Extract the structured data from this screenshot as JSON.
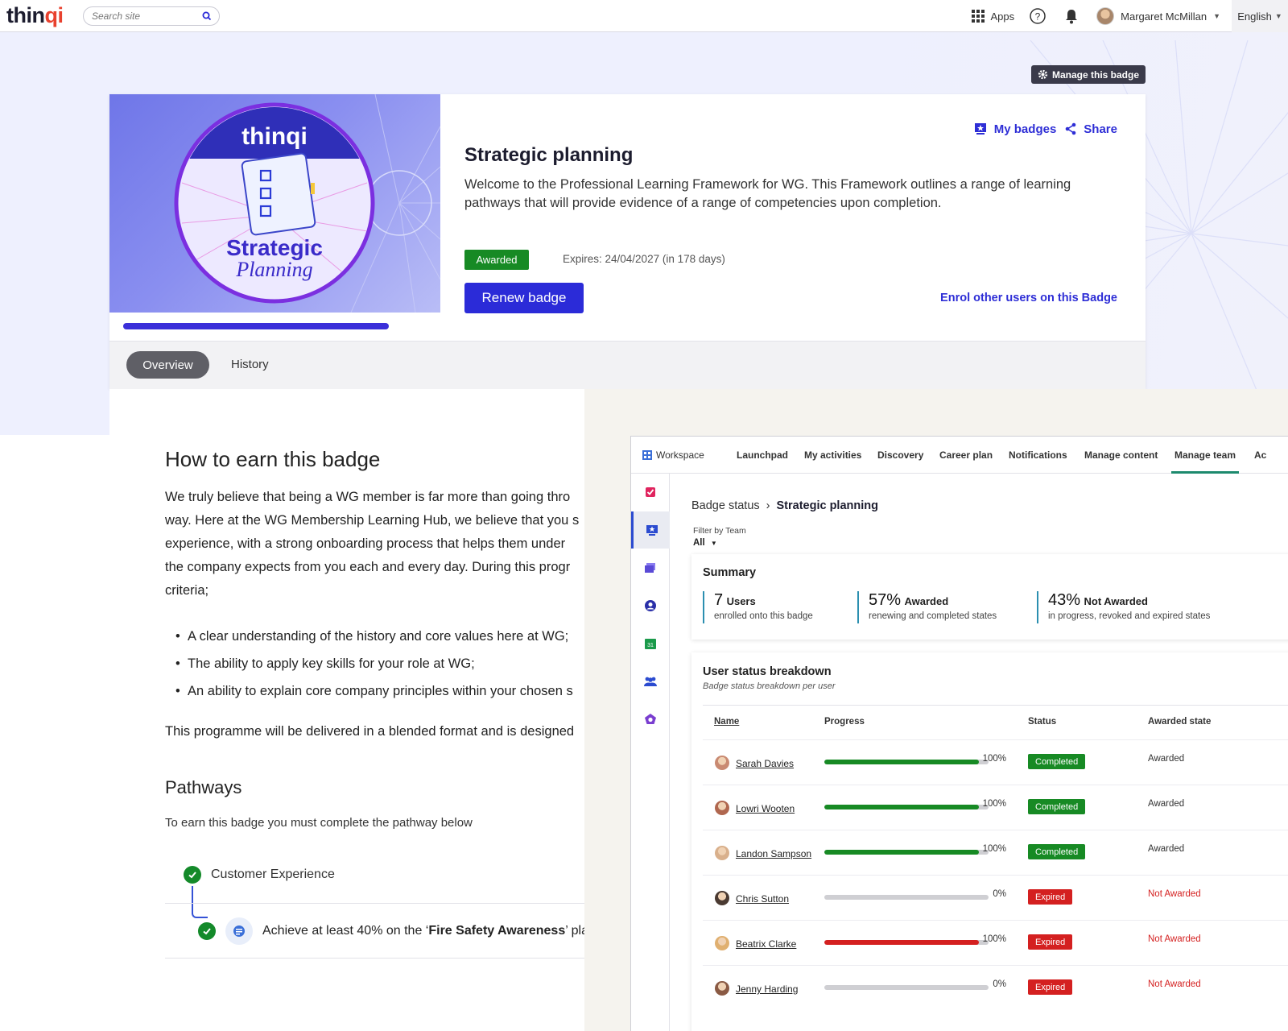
{
  "topbar": {
    "logo_main": "thin",
    "logo_accent": "qi",
    "search_placeholder": "Search site",
    "apps_label": "Apps",
    "user_name": "Margaret McMillan",
    "language": "English"
  },
  "manage_badge_label": "Manage this badge",
  "badge": {
    "image_brand": "thinqi",
    "image_title_line1": "Strategic",
    "image_title_line2": "Planning",
    "title": "Strategic planning",
    "description": "Welcome to the Professional Learning Framework for WG. This Framework outlines a range of learning pathways that will provide evidence of a range of competencies upon completion.",
    "my_badges_label": "My badges",
    "share_label": "Share",
    "status_pill": "Awarded",
    "expires": "Expires: 24/04/2027 (in 178 days)",
    "renew_label": "Renew badge",
    "enrol_label": "Enrol other users on this Badge",
    "tabs": [
      "Overview",
      "History"
    ],
    "colors": {
      "primary": "#2b2bd8",
      "awarded": "#178a24"
    }
  },
  "content": {
    "heading": "How to earn this badge",
    "paragraph_lines": [
      "We truly believe that being a WG member is far more than going thro",
      "way. Here at the WG Membership Learning Hub, we believe that you s",
      "experience, with a strong onboarding process that helps them under",
      "the company expects from you each and every day. During this progr",
      "criteria;"
    ],
    "bullets": [
      "A clear understanding of the history and core values here at WG;",
      "The ability to apply key skills for your role at WG;",
      "An ability to explain core company principles within your chosen s"
    ],
    "delivered": "This programme will be delivered in a blended format and is designed",
    "pathways_heading": "Pathways",
    "pathways_intro": "To earn this badge you must complete the pathway below",
    "step1": "Customer Experience",
    "step2_prefix": "Achieve at least 40% on the ‘",
    "step2_bold": "Fire Safety Awareness",
    "step2_suffix": "’ playl"
  },
  "manage_team": {
    "nav": {
      "workspace": "Workspace",
      "items": [
        "Launchpad",
        "My activities",
        "Discovery",
        "Career plan",
        "Notifications",
        "Manage content",
        "Manage team",
        "Ac"
      ],
      "active": "Manage team"
    },
    "breadcrumb": {
      "parent": "Badge status",
      "current": "Strategic planning"
    },
    "filter_label": "Filter by Team",
    "filter_value": "All",
    "summary": {
      "title": "Summary",
      "stats": [
        {
          "value": "7",
          "label": "Users",
          "sub": "enrolled onto this badge"
        },
        {
          "value": "57%",
          "label": "Awarded",
          "sub": "renewing and completed states"
        },
        {
          "value": "43%",
          "label": "Not Awarded",
          "sub": "in progress, revoked and expired states"
        }
      ]
    },
    "breakdown": {
      "title": "User status breakdown",
      "subtitle": "Badge status breakdown per user",
      "headers": [
        "Name",
        "Progress",
        "Status",
        "Awarded state"
      ],
      "rows": [
        {
          "name": "Sarah Davies",
          "progress": 100,
          "progress_label": "100%",
          "status": "Completed",
          "awarded": "Awarded",
          "bar_color": "#178a24",
          "status_color": "#178a24",
          "awarded_color": "#333333",
          "avatar_color": "#c98a72"
        },
        {
          "name": "Lowri Wooten",
          "progress": 100,
          "progress_label": "100%",
          "status": "Completed",
          "awarded": "Awarded",
          "bar_color": "#178a24",
          "status_color": "#178a24",
          "awarded_color": "#333333",
          "avatar_color": "#b0674f"
        },
        {
          "name": "Landon Sampson",
          "progress": 100,
          "progress_label": "100%",
          "status": "Completed",
          "awarded": "Awarded",
          "bar_color": "#178a24",
          "status_color": "#178a24",
          "awarded_color": "#333333",
          "avatar_color": "#d9b08c"
        },
        {
          "name": "Chris Sutton",
          "progress": 0,
          "progress_label": "0%",
          "status": "Expired",
          "awarded": "Not Awarded",
          "bar_color": "#d42020",
          "status_color": "#d42020",
          "awarded_color": "#d42020",
          "avatar_color": "#4a3a32"
        },
        {
          "name": "Beatrix Clarke",
          "progress": 100,
          "progress_label": "100%",
          "status": "Expired",
          "awarded": "Not Awarded",
          "bar_color": "#d42020",
          "status_color": "#d42020",
          "awarded_color": "#d42020",
          "avatar_color": "#e0b070"
        },
        {
          "name": "Jenny Harding",
          "progress": 0,
          "progress_label": "0%",
          "status": "Expired",
          "awarded": "Not Awarded",
          "bar_color": "#d42020",
          "status_color": "#d42020",
          "awarded_color": "#d42020",
          "avatar_color": "#8a5a44"
        }
      ]
    }
  }
}
